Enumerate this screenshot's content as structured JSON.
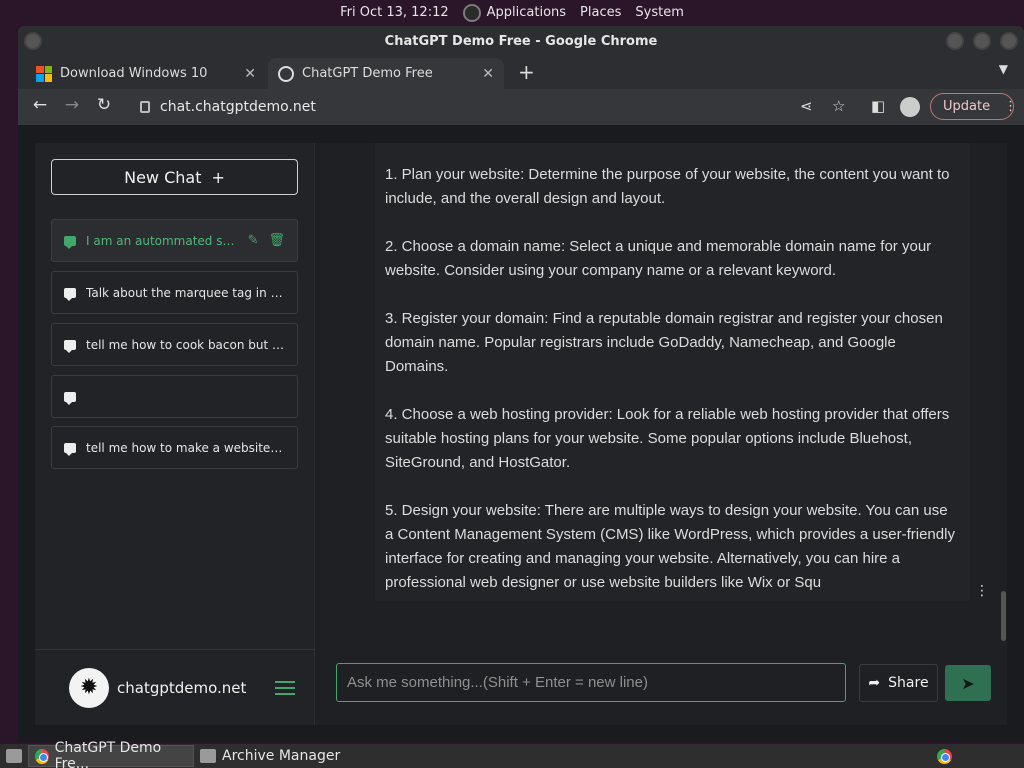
{
  "top_panel": {
    "datetime": "Fri Oct 13, 12:12",
    "applications": "Applications",
    "places": "Places",
    "system": "System"
  },
  "window": {
    "title": "ChatGPT Demo Free - Google Chrome"
  },
  "tabs": [
    {
      "label": "Download Windows 10"
    },
    {
      "label": "ChatGPT Demo Free"
    }
  ],
  "toolbar": {
    "url": "chat.chatgptdemo.net",
    "update_label": "Update"
  },
  "sidebar": {
    "new_chat_label": "New Chat",
    "chats": [
      {
        "label": "I am an autommated scri..."
      },
      {
        "label": "Talk about the marquee tag in gre..."
      },
      {
        "label": "tell me how to cook bacon but wri..."
      },
      {
        "label": ""
      },
      {
        "label": "tell me how to make a website but..."
      }
    ],
    "brand": "chatgptdemo.net"
  },
  "message": {
    "paragraphs": [
      "1. Plan your website: Determine the purpose of your website, the content you want to include, and the overall design and layout.",
      "2. Choose a domain name: Select a unique and memorable domain name for your website. Consider using your company name or a relevant keyword.",
      "3. Register your domain: Find a reputable domain registrar and register your chosen domain name. Popular registrars include GoDaddy, Namecheap, and Google Domains.",
      "4. Choose a web hosting provider: Look for a reliable web hosting provider that offers suitable hosting plans for your website. Some popular options include Bluehost, SiteGround, and HostGator.",
      "5. Design your website: There are multiple ways to design your website. You can use a Content Management System (CMS) like WordPress, which provides a user-friendly interface for creating and managing your website. Alternatively, you can hire a professional web designer or use website builders like Wix or Squ"
    ]
  },
  "composer": {
    "placeholder": "Ask me something...(Shift + Enter = new line)",
    "share_label": "Share"
  },
  "taskbar": {
    "chrome_task": "ChatGPT Demo Fre...",
    "archive_task": "Archive Manager"
  }
}
